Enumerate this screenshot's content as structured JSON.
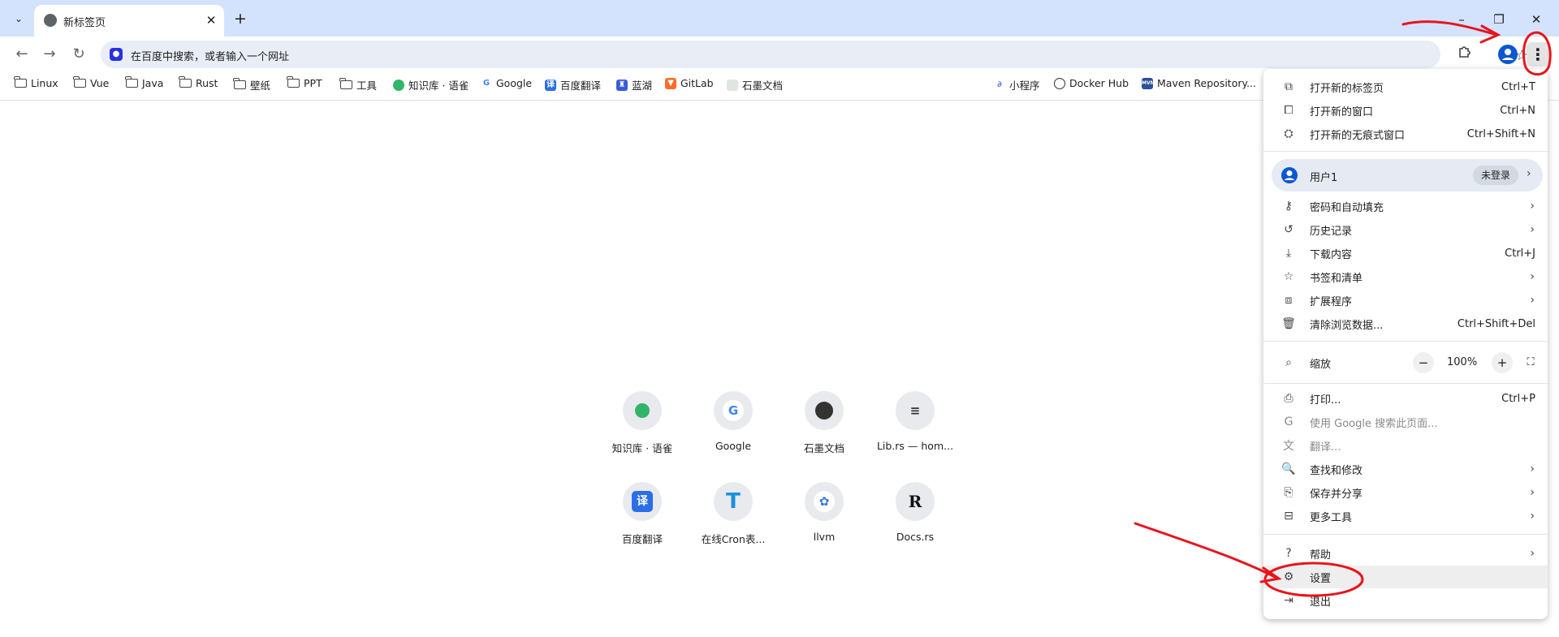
{
  "tab": {
    "title": "新标签页"
  },
  "window_controls": {
    "minimize": "–",
    "restore": "❐",
    "close": "✕"
  },
  "omnibox": {
    "placeholder": "在百度中搜索，或者输入一个网址",
    "engine_icon": "baidu-paw-icon"
  },
  "bookmarks": {
    "left": [
      {
        "label": "Linux",
        "icon": "folder"
      },
      {
        "label": "Vue",
        "icon": "folder"
      },
      {
        "label": "Java",
        "icon": "folder"
      },
      {
        "label": "Rust",
        "icon": "folder"
      },
      {
        "label": "壁纸",
        "icon": "folder"
      },
      {
        "label": "PPT",
        "icon": "folder"
      },
      {
        "label": "工具",
        "icon": "folder"
      },
      {
        "label": "知识库 · 语雀",
        "icon": "yuque"
      },
      {
        "label": "Google",
        "icon": "google"
      },
      {
        "label": "百度翻译",
        "icon": "baidu-fanyi"
      },
      {
        "label": "蓝湖",
        "icon": "lanhu"
      },
      {
        "label": "GitLab",
        "icon": "gitlab"
      },
      {
        "label": "石墨文档",
        "icon": "shimo"
      }
    ],
    "right": [
      {
        "label": "小程序",
        "icon": "miniprogram"
      },
      {
        "label": "Docker Hub",
        "icon": "docker"
      },
      {
        "label": "Maven Repository...",
        "icon": "maven"
      }
    ]
  },
  "shortcuts": [
    {
      "label": "知识库 · 语雀",
      "glyph": "",
      "color": "#31b56a"
    },
    {
      "label": "Google",
      "glyph": "G",
      "color": "#4285f4"
    },
    {
      "label": "石墨文档",
      "glyph": "",
      "color": "#333333"
    },
    {
      "label": "Lib.rs — hom...",
      "glyph": "≡",
      "color": "#333333"
    },
    {
      "label": "百度翻译",
      "glyph": "译",
      "color": "#2b6ee8"
    },
    {
      "label": "在线Cron表...",
      "glyph": "T",
      "color": "#1a8fe0"
    },
    {
      "label": "llvm",
      "glyph": "✿",
      "color": "#3a78d8"
    },
    {
      "label": "Docs.rs",
      "glyph": "R",
      "color": "#111111"
    }
  ],
  "menu": {
    "new_tab": {
      "label": "打开新的标签页",
      "shortcut": "Ctrl+T"
    },
    "new_window": {
      "label": "打开新的窗口",
      "shortcut": "Ctrl+N"
    },
    "new_incognito": {
      "label": "打开新的无痕式窗口",
      "shortcut": "Ctrl+Shift+N"
    },
    "profile": {
      "label": "用户1",
      "badge": "未登录"
    },
    "passwords": {
      "label": "密码和自动填充"
    },
    "history": {
      "label": "历史记录"
    },
    "downloads": {
      "label": "下载内容",
      "shortcut": "Ctrl+J"
    },
    "bookmarks": {
      "label": "书签和清单"
    },
    "extensions": {
      "label": "扩展程序"
    },
    "clear_data": {
      "label": "清除浏览数据...",
      "shortcut": "Ctrl+Shift+Del"
    },
    "zoom": {
      "label": "缩放",
      "value": "100%",
      "minus": "−",
      "plus": "+"
    },
    "print": {
      "label": "打印...",
      "shortcut": "Ctrl+P"
    },
    "search_page": {
      "label": "使用 Google 搜索此页面..."
    },
    "translate": {
      "label": "翻译..."
    },
    "find": {
      "label": "查找和修改"
    },
    "save_share": {
      "label": "保存并分享"
    },
    "more_tools": {
      "label": "更多工具"
    },
    "help": {
      "label": "帮助"
    },
    "settings": {
      "label": "设置"
    },
    "exit": {
      "label": "退出"
    }
  },
  "colors": {
    "tabstrip": "#d3e3fd",
    "annotation": "#e8141c",
    "accent": "#0b57d0"
  }
}
